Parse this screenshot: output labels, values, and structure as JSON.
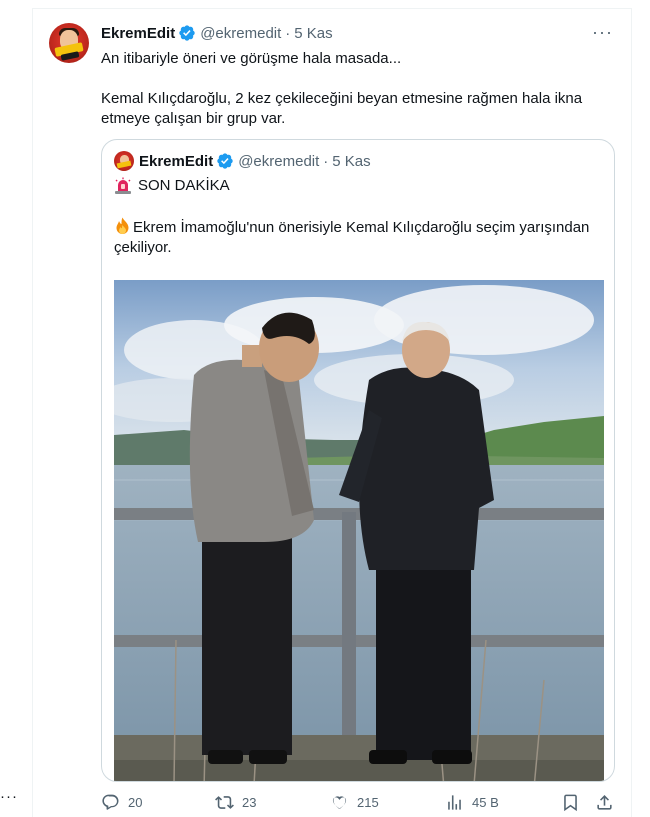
{
  "page": {
    "left_overflow_dots": "···"
  },
  "tweet": {
    "author_name": "EkremEdit",
    "author_handle": "@ekremedit",
    "separator": "·",
    "time": "5 Kas",
    "more_label": "···",
    "text_lines": [
      "An itibariyle öneri ve görüşme hala masada...",
      "Kemal Kılıçdaroğlu,  2 kez çekileceğini beyan etmesine rağmen hala ikna etmeye çalışan bir grup var."
    ],
    "quoted": {
      "author_name": "EkremEdit",
      "author_handle": "@ekremedit",
      "separator": "·",
      "time": "5 Kas",
      "lines": {
        "headline": "SON DAKİKA",
        "body": "Ekrem İmamoğlu'nun önerisiyle Kemal Kılıçdaroğlu seçim yarışından çekiliyor."
      },
      "icons": {
        "headline": "rotating-light-emoji",
        "body": "fire-emoji"
      }
    },
    "actions": {
      "replies": "20",
      "retweets": "23",
      "likes": "215",
      "views": "45 B"
    }
  },
  "colors": {
    "text_primary": "#0f1419",
    "text_secondary": "#536471",
    "verified_blue": "#1d9bf0",
    "border": "#cfd9de"
  },
  "icons": [
    "verified-badge-icon",
    "more-icon",
    "reply-icon",
    "retweet-icon",
    "like-icon",
    "views-icon",
    "bookmark-icon",
    "share-icon"
  ]
}
